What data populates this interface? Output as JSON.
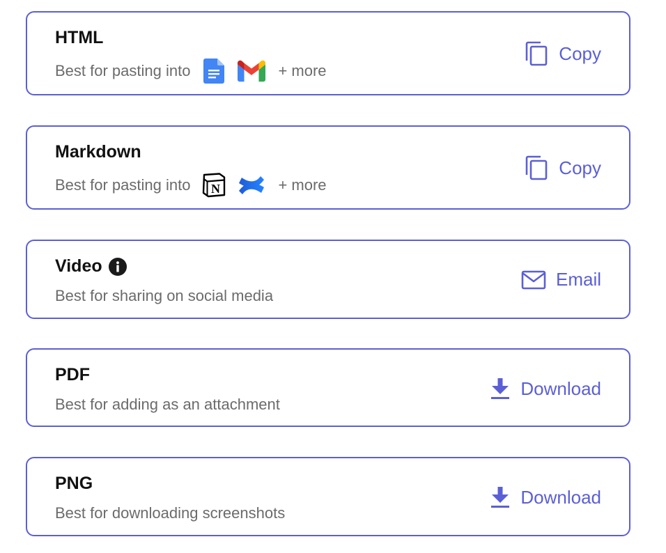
{
  "accent_color": "#5b5fd6",
  "desc_prefix": "Best for pasting into",
  "more_label": "+ more",
  "options": [
    {
      "title": "HTML",
      "apps": [
        "google-docs-icon",
        "gmail-icon"
      ],
      "action_label": "Copy",
      "action_icon": "copy-icon"
    },
    {
      "title": "Markdown",
      "apps": [
        "notion-icon",
        "confluence-icon"
      ],
      "action_label": "Copy",
      "action_icon": "copy-icon"
    },
    {
      "title": "Video",
      "title_icon": "info-icon",
      "description": "Best for sharing on social media",
      "action_label": "Email",
      "action_icon": "mail-icon"
    },
    {
      "title": "PDF",
      "description": "Best for adding as an attachment",
      "action_label": "Download",
      "action_icon": "download-icon"
    },
    {
      "title": "PNG",
      "description": "Best for downloading screenshots",
      "action_label": "Download",
      "action_icon": "download-icon"
    }
  ]
}
